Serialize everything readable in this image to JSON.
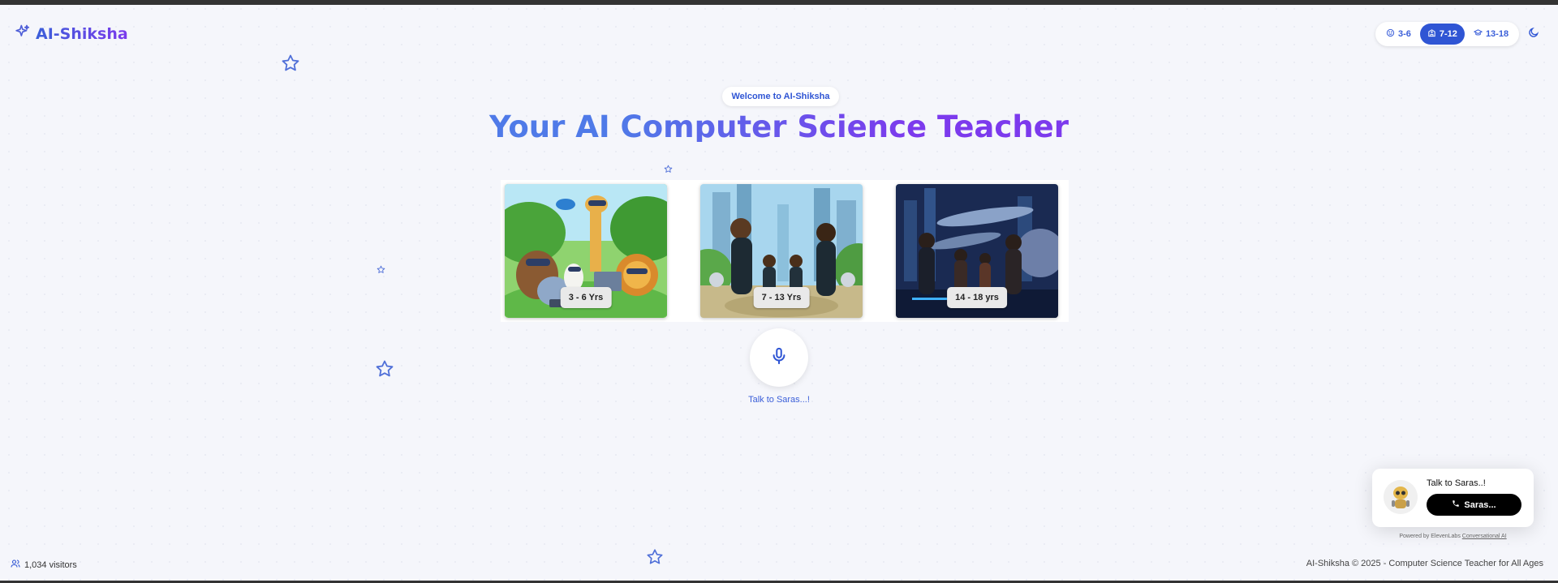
{
  "header": {
    "logo_text": "AI-Shiksha",
    "age_filters": [
      {
        "label": "3-6",
        "icon": "smile-icon",
        "active": false
      },
      {
        "label": "7-12",
        "icon": "school-icon",
        "active": true
      },
      {
        "label": "13-18",
        "icon": "graduation-cap-icon",
        "active": false
      }
    ],
    "theme_toggle_icon": "moon-icon"
  },
  "hero": {
    "badge": "Welcome to AI-Shiksha",
    "title": "Your AI Computer Science Teacher"
  },
  "age_cards": [
    {
      "label": "3 - 6 Yrs",
      "scene": "cartoon animals with VR headsets and laptops"
    },
    {
      "label": "7 - 13 Yrs",
      "scene": "kids in futuristic suits with robots"
    },
    {
      "label": "14 - 18 yrs",
      "scene": "teens in sci-fi city with spaceships"
    }
  ],
  "voice": {
    "mic_icon": "mic-icon",
    "caption": "Talk to Saras...!"
  },
  "widget": {
    "title": "Talk to Saras..!",
    "button_label": "Saras...",
    "button_icon": "phone-icon",
    "powered_prefix": "Powered by ElevenLabs",
    "powered_link": "Conversational AI"
  },
  "footer": {
    "visitors": "1,034 visitors",
    "copyright": "AI-Shiksha © 2025 - Computer Science Teacher for All Ages"
  },
  "colors": {
    "accent": "#2f55d4",
    "gradient_start": "#4f7ae8",
    "gradient_end": "#7c3aed",
    "background": "#f5f6fb"
  }
}
